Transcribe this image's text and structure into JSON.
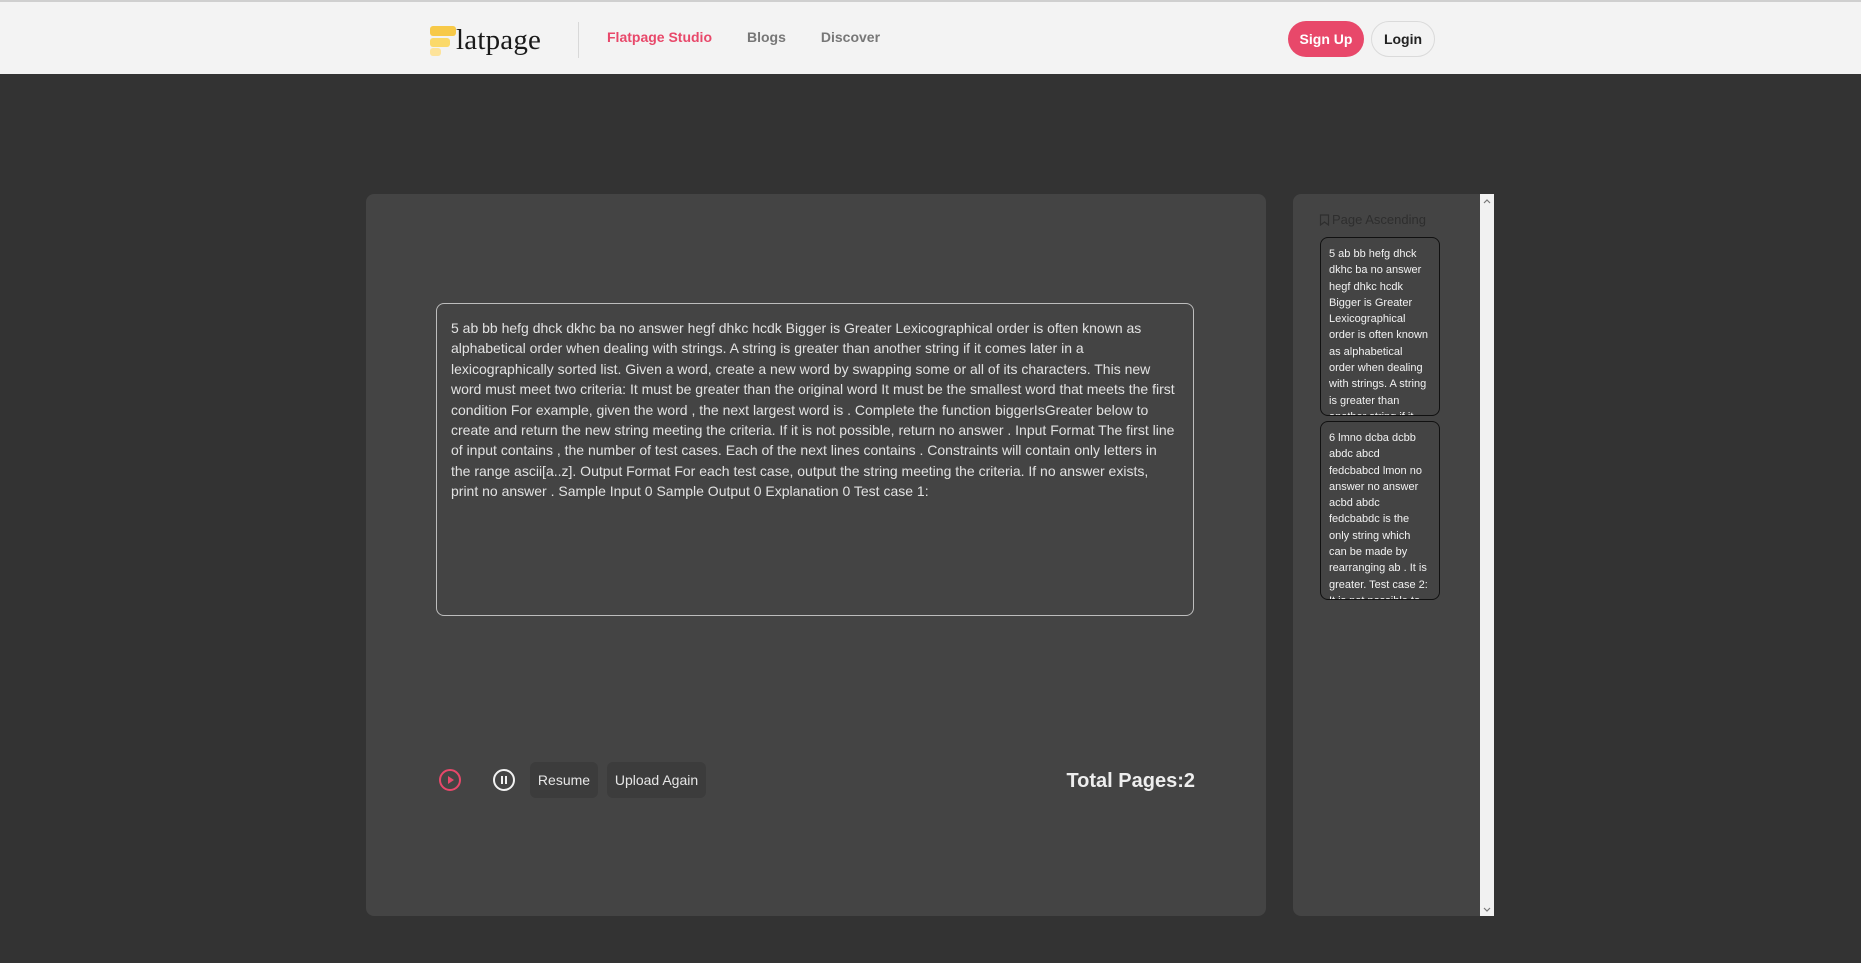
{
  "header": {
    "logo_text": "latpage",
    "nav": [
      {
        "label": "Flatpage Studio"
      },
      {
        "label": "Blogs"
      },
      {
        "label": "Discover"
      }
    ],
    "signup_label": "Sign Up",
    "login_label": "Login"
  },
  "main": {
    "text": "5 ab bb hefg dhck dkhc ba no answer hegf dhkc hcdk Bigger is Greater Lexicographical order is often known as alphabetical order when dealing with strings. A string is greater than another string if it comes later in a lexicographically sorted list. Given a word, create a new word by swapping some or all of its characters. This new word must meet two criteria: It must be greater than the original word It must be the smallest word that meets the first condition For example, given the word , the next largest word is . Complete the function biggerIsGreater below to create and return the new string meeting the criteria. If it is not possible, return no answer . Input Format The first line of input contains , the number of test cases. Each of the next lines contains . Constraints will contain only letters in the range ascii[a..z]. Output Format For each test case, output the string meeting the criteria. If no answer exists, print no answer . Sample Input 0 Sample Output 0 Explanation 0 Test case 1:",
    "resume_label": "Resume",
    "upload_label": "Upload Again",
    "total_pages": "Total Pages:2"
  },
  "sidebar": {
    "header": "Page Ascending",
    "pages": [
      {
        "text": "5 ab bb hefg dhck dkhc ba no answer hegf dhkc hcdk Bigger is Greater Lexicographical order is often known as alphabetical order when dealing with strings. A string is greater than another string if it comes later in a lexicographically sorted list."
      },
      {
        "text": "6 lmno dcba dcbb abdc abcd fedcbabcd lmon no answer no answer acbd abdc fedcbabdc is the only string which can be made by rearranging ab . It is greater. Test case 2: It is not possible to rearrange bb and get a greater string."
      }
    ]
  },
  "colors": {
    "accent": "#e8486a",
    "background": "#333333",
    "panel": "#444444",
    "header_bg": "#f3f3f3"
  },
  "icons": [
    "play-circle-icon",
    "pause-circle-icon",
    "bookmark-icon"
  ]
}
